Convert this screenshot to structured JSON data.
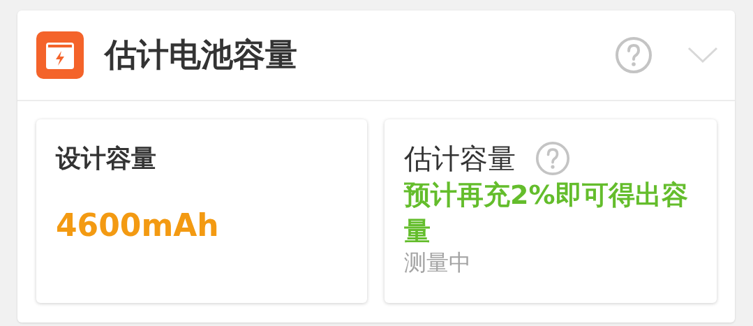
{
  "header": {
    "title": "估计电池容量"
  },
  "cards": [
    {
      "kind": "value",
      "label": "设计容量",
      "value": "4600mAh"
    },
    {
      "kind": "status",
      "label": "估计容量",
      "note": "预计再充2%即可得出容量",
      "status": "测量中"
    }
  ]
}
